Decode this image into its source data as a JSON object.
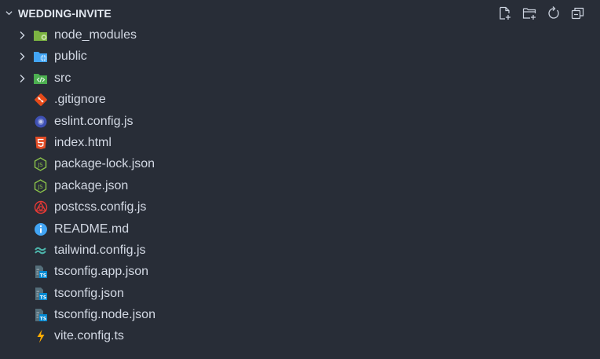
{
  "explorer": {
    "title": "WEDDING-INVITE",
    "actions": [
      {
        "name": "new-file-icon"
      },
      {
        "name": "new-folder-icon"
      },
      {
        "name": "refresh-icon"
      },
      {
        "name": "collapse-all-icon"
      }
    ],
    "items": [
      {
        "label": "node_modules",
        "type": "folder",
        "icon": "node-folder-icon"
      },
      {
        "label": "public",
        "type": "folder",
        "icon": "public-folder-icon"
      },
      {
        "label": "src",
        "type": "folder",
        "icon": "src-folder-icon"
      },
      {
        "label": ".gitignore",
        "type": "file",
        "icon": "git-icon"
      },
      {
        "label": "eslint.config.js",
        "type": "file",
        "icon": "eslint-icon"
      },
      {
        "label": "index.html",
        "type": "file",
        "icon": "html-icon"
      },
      {
        "label": "package-lock.json",
        "type": "file",
        "icon": "nodejs-icon"
      },
      {
        "label": "package.json",
        "type": "file",
        "icon": "nodejs-icon"
      },
      {
        "label": "postcss.config.js",
        "type": "file",
        "icon": "postcss-icon"
      },
      {
        "label": "README.md",
        "type": "file",
        "icon": "info-icon"
      },
      {
        "label": "tailwind.config.js",
        "type": "file",
        "icon": "tailwind-icon"
      },
      {
        "label": "tsconfig.app.json",
        "type": "file",
        "icon": "tsconfig-icon"
      },
      {
        "label": "tsconfig.json",
        "type": "file",
        "icon": "tsconfig-icon"
      },
      {
        "label": "tsconfig.node.json",
        "type": "file",
        "icon": "tsconfig-icon"
      },
      {
        "label": "vite.config.ts",
        "type": "file",
        "icon": "vite-icon"
      }
    ]
  },
  "colors": {
    "background": "#282d37",
    "text": "#d3d9e4",
    "folder_green": "#7cb342",
    "folder_blue": "#42a5f5",
    "git": "#e64a19",
    "html": "#e44d26",
    "eslint": "#3f51b5",
    "node": "#8bc34a",
    "postcss": "#e53935",
    "info": "#42a5f5",
    "tailwind": "#4db6ac",
    "ts": "#0288d1",
    "vite": "#ffab00"
  }
}
